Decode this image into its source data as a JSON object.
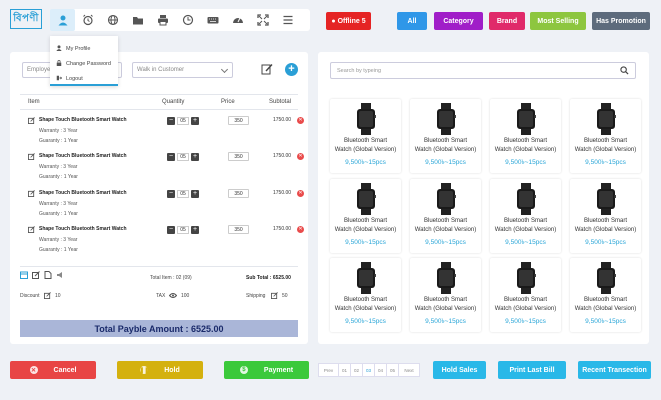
{
  "logo": {
    "text": "বিপণী"
  },
  "toolbar_icons": [
    {
      "name": "user-icon",
      "active": true
    },
    {
      "name": "alarm-clock-icon"
    },
    {
      "name": "globe-icon"
    },
    {
      "name": "folder-icon"
    },
    {
      "name": "printer-icon"
    },
    {
      "name": "clock-icon"
    },
    {
      "name": "keyboard-icon"
    },
    {
      "name": "dashboard-gauge-icon"
    },
    {
      "name": "fullscreen-icon"
    },
    {
      "name": "menu-icon"
    }
  ],
  "offline_badge": "● Offline 5",
  "filters": {
    "all": "All",
    "category": "Category",
    "brand": "Brand",
    "most_selling": "Most Selling",
    "has_promotion": "Has Promotion"
  },
  "colors": {
    "accent": "#2a9fd6",
    "offline": "#e52424",
    "all": "#2f97e8",
    "category": "#a01ec8",
    "brand": "#e02a6a",
    "most_selling": "#8dc63f",
    "has_promotion": "#5d6b7c",
    "cancel": "#e84545",
    "hold": "#d4b10f",
    "payment": "#3bc93b",
    "cyan": "#29b8e8"
  },
  "profile_menu": {
    "my_profile": "My Profile",
    "change_password": "Change Password",
    "logout": "Logout"
  },
  "employee_select": "Employe",
  "customer_select": "Walk in Customer",
  "table": {
    "headers": {
      "item": "Item",
      "quantity": "Quantity",
      "price": "Price",
      "subtotal": "Subtotal"
    },
    "rows": [
      {
        "name": "Shape Touch Bluetooth Smart Watch",
        "warranty": "Warranty : 3 Year",
        "guaranty": "Guaranty : 1 Year",
        "qty": "05",
        "price": "350",
        "subtotal": "1750.00"
      },
      {
        "name": "Shape Touch Bluetooth Smart Watch",
        "warranty": "Warranty : 3 Year",
        "guaranty": "Guaranty : 1 Year",
        "qty": "05",
        "price": "350",
        "subtotal": "1750.00"
      },
      {
        "name": "Shape Touch Bluetooth Smart Watch",
        "warranty": "Warranty : 3 Year",
        "guaranty": "Guaranty : 1 Year",
        "qty": "05",
        "price": "350",
        "subtotal": "1750.00"
      },
      {
        "name": "Shape Touch Bluetooth Smart Watch",
        "warranty": "Warranty : 3 Year",
        "guaranty": "Guaranty : 1 Year",
        "qty": "05",
        "price": "350",
        "subtotal": "1750.00"
      }
    ]
  },
  "summary": {
    "total_item": "Total Item : 02 (09)",
    "sub_total": "Sub Total : 6525.00",
    "discount_label": "Discount",
    "discount_value": "10",
    "tax_label": "TAX",
    "tax_value": "100",
    "shipping_label": "Shipping",
    "shipping_value": "50"
  },
  "total_payable": "Total Payble Amount : 6525.00",
  "search_placeholder": "Search by typeing",
  "product": {
    "title_line1": "Bluetooth Smart",
    "title_line2": "Watch (Global Version)",
    "price": "9,500৳~15pcs"
  },
  "buttons": {
    "cancel": "Cancel",
    "hold": "Hold",
    "payment": "Payment",
    "hold_sales": "Hold Sales",
    "print_last_bill": "Print Last Bill",
    "recent_transection": "Recent Transection"
  },
  "pager": {
    "prev": "Prev",
    "pages": [
      "01",
      "02",
      "03",
      "04",
      "05"
    ],
    "active": "03",
    "next": "Next"
  }
}
